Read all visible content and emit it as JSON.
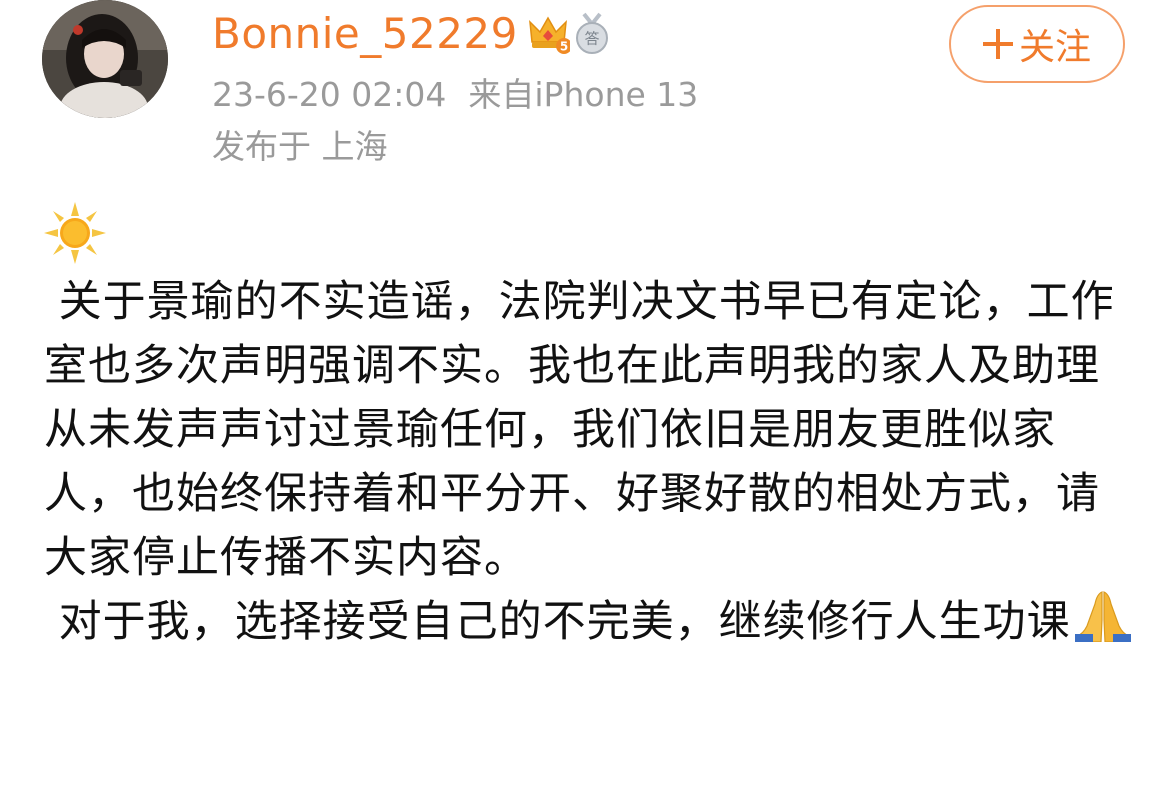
{
  "user": {
    "name": "Bonnie_52229",
    "vip_level": "5",
    "medal_char": "答"
  },
  "meta": {
    "date": "23-6-20 02:04",
    "source": "来自iPhone 13",
    "location": "发布于 上海"
  },
  "follow_button": {
    "label": "关注"
  },
  "post": {
    "leading_emoji": "sun",
    "paragraph_1": " 关于景瑜的不实造谣，法院判决文书早已有定论，工作室也多次声明强调不实。我也在此声明我的家人及助理从未发声声讨过景瑜任何，我们依旧是朋友更胜似家人，也始终保持着和平分开、好聚好散的相处方式，请大家停止传播不实内容。",
    "paragraph_2": " 对于我，选择接受自己的不完美，继续修行人生功课",
    "trailing_emoji": "folded-hands"
  },
  "colors": {
    "accent": "#f07b2c",
    "meta_gray": "#9a9a9a",
    "follow_border": "#f5a06b"
  }
}
